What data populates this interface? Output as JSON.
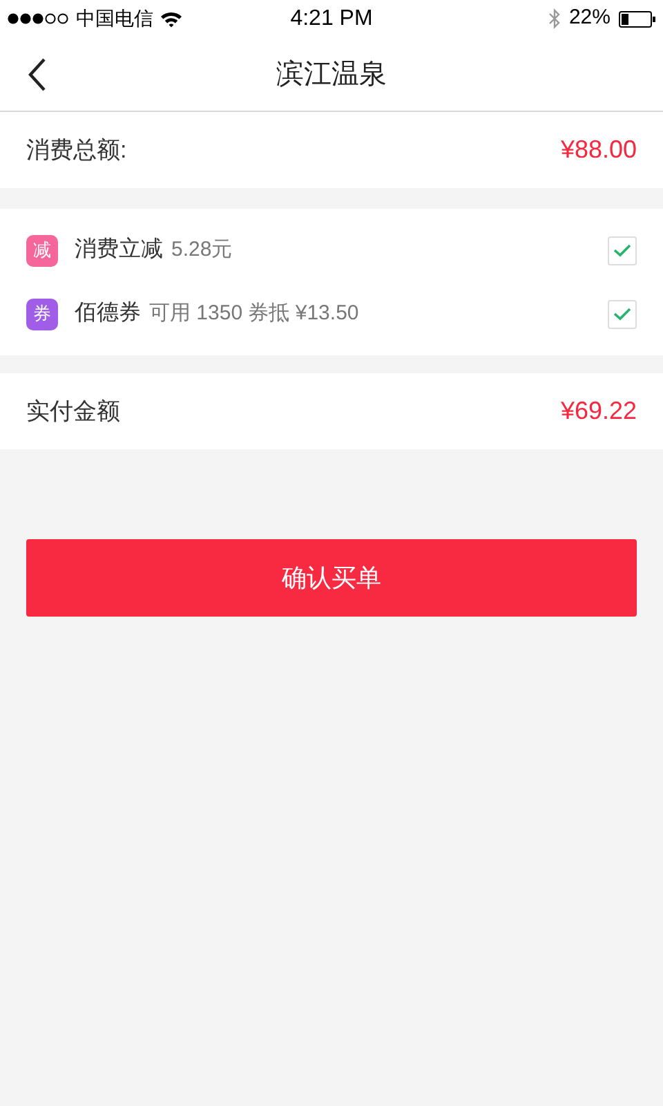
{
  "status_bar": {
    "carrier": "中国电信",
    "time": "4:21 PM",
    "battery": "22%"
  },
  "nav": {
    "title": "滨江温泉"
  },
  "total": {
    "label": "消费总额:",
    "amount": "¥88.00"
  },
  "discounts": [
    {
      "badge": "减",
      "color": "#f5679a",
      "label": "消费立减",
      "detail": "5.28元",
      "checked": true
    },
    {
      "badge": "券",
      "color": "#a05ee8",
      "label": "佰德券",
      "detail": "可用 1350 券抵 ¥13.50",
      "checked": true
    }
  ],
  "payable": {
    "label": "实付金额",
    "amount": "¥69.22"
  },
  "confirm_button": "确认买单"
}
